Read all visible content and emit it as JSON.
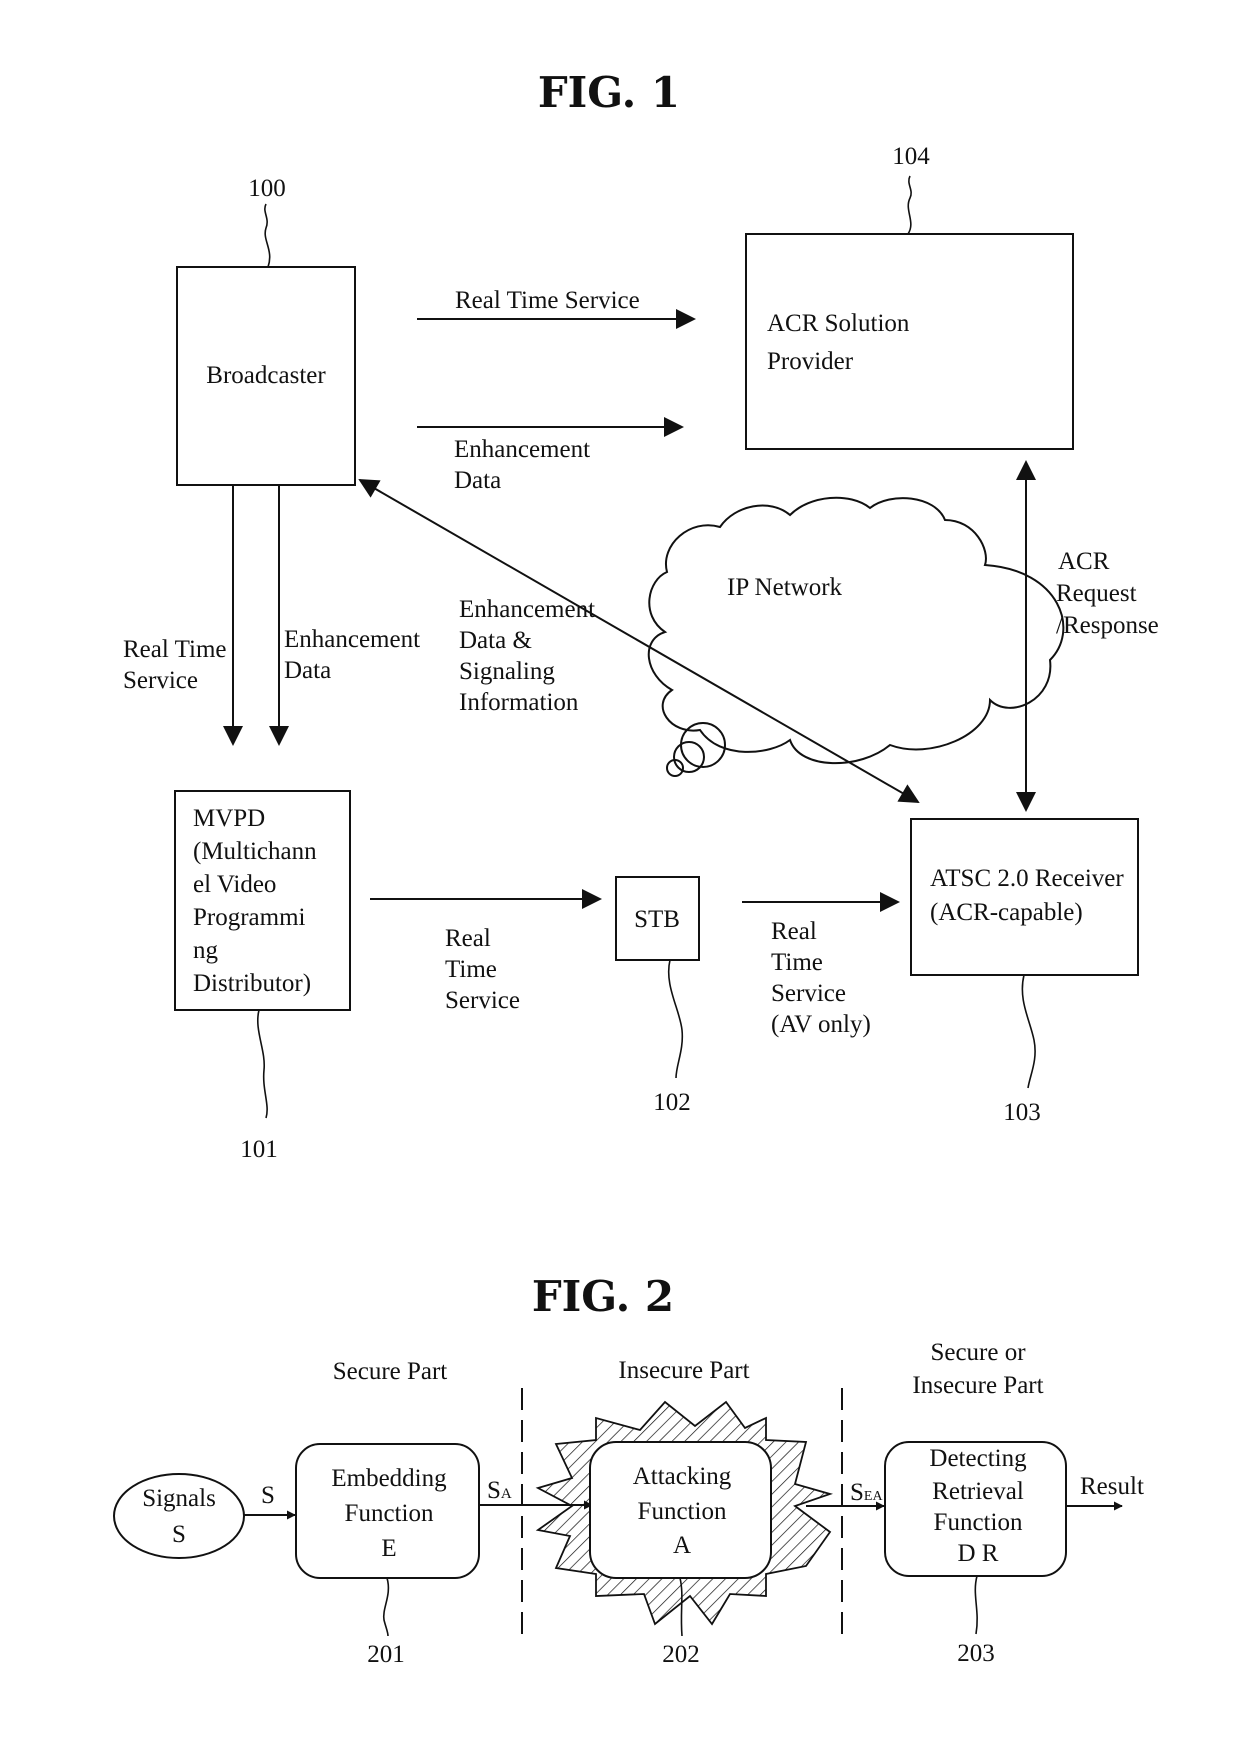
{
  "figures": [
    {
      "title": "FIG. 1",
      "nodes": {
        "broadcaster": {
          "label": "Broadcaster",
          "ref": "100"
        },
        "acr_provider": {
          "label_lines": [
            "ACR Solution",
            "Provider"
          ],
          "ref": "104"
        },
        "mvpd": {
          "label_lines": [
            "MVPD",
            "(Multichann",
            "el Video",
            "Programmi",
            "ng",
            "Distributor)"
          ],
          "ref": "101"
        },
        "stb": {
          "label": "STB",
          "ref": "102"
        },
        "receiver": {
          "label_lines": [
            "ATSC 2.0 Receiver",
            "(ACR-capable)"
          ],
          "ref": "103"
        },
        "ip_network": {
          "label": "IP Network"
        }
      },
      "edges": {
        "bc_to_acr_rts": {
          "label_lines": [
            "Real Time Service"
          ]
        },
        "bc_to_acr_enh": {
          "label_lines": [
            "Enhancement",
            "Data"
          ]
        },
        "bc_to_mvpd_rts": {
          "label_lines": [
            "Real Time",
            "Service"
          ]
        },
        "bc_to_mvpd_enh": {
          "label_lines": [
            "Enhancement",
            "Data"
          ]
        },
        "bc_receiver_enh_sig": {
          "label_lines": [
            "Enhancement",
            "Data &",
            "Signaling",
            "Information"
          ]
        },
        "acr_req_resp": {
          "label_lines": [
            "ACR",
            "Request",
            "/Response"
          ]
        },
        "mvpd_to_stb": {
          "label_lines": [
            "Real",
            "Time",
            "Service"
          ]
        },
        "stb_to_receiver": {
          "label_lines": [
            "Real",
            "Time",
            "Service",
            "(AV only)"
          ]
        }
      }
    },
    {
      "title": "FIG. 2",
      "sections": {
        "secure": {
          "label_lines": [
            "Secure Part"
          ]
        },
        "insecure": {
          "label_lines": [
            "Insecure Part"
          ]
        },
        "secure_or_insecure": {
          "label_lines": [
            "Secure or",
            "Insecure Part"
          ]
        }
      },
      "nodes": {
        "signals": {
          "label_lines": [
            "Signals",
            "S"
          ]
        },
        "embedding": {
          "label_lines": [
            "Embedding",
            "Function",
            "E"
          ],
          "ref": "201"
        },
        "attacking": {
          "label_lines": [
            "Attacking",
            "Function",
            "A"
          ],
          "ref": "202"
        },
        "detecting": {
          "label_lines": [
            "Detecting",
            "Retrieval",
            "Function",
            "D R"
          ],
          "ref": "203"
        }
      },
      "edges": {
        "s": {
          "label": "S"
        },
        "sa": {
          "label": "S",
          "sub": "A"
        },
        "sea": {
          "label": "S",
          "sub": "EA"
        },
        "result": {
          "label": "Result"
        }
      }
    }
  ]
}
